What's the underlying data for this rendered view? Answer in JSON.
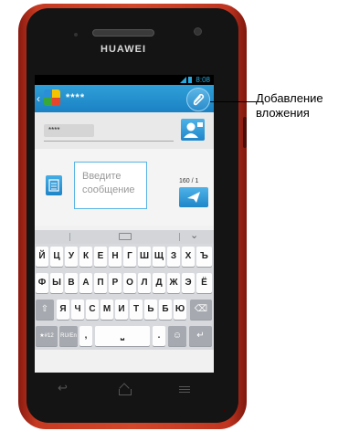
{
  "device": {
    "brand": "HUAWEI"
  },
  "status_bar": {
    "time": "8:08",
    "color": "#2aa9e0"
  },
  "header": {
    "back_glyph": "‹",
    "title": "****",
    "accent": "#1b82c4"
  },
  "annotation": {
    "label_line1": "Добавление",
    "label_line2": "вложения"
  },
  "recipients": {
    "chip": "****"
  },
  "compose": {
    "placeholder_line1": "Введите",
    "placeholder_line2": "сообщение",
    "counter": "160 / 1"
  },
  "keyboard": {
    "row1": [
      "Й",
      "Ц",
      "У",
      "К",
      "Е",
      "Н",
      "Г",
      "Ш",
      "Щ",
      "З",
      "Х",
      "Ъ"
    ],
    "row2": [
      "Ф",
      "Ы",
      "В",
      "А",
      "П",
      "Р",
      "О",
      "Л",
      "Д",
      "Ж",
      "Э",
      "Ё"
    ],
    "row3": [
      "Я",
      "Ч",
      "С",
      "М",
      "И",
      "Т",
      "Ь",
      "Б",
      "Ю"
    ],
    "shift": "⇧",
    "backspace": "⌫",
    "symbols": "★#12",
    "lang": "RU/En",
    "comma": ",",
    "space": "⎵",
    "period": ".",
    "emoji": "☺",
    "enter": "↵"
  },
  "nav": {
    "back": "↩"
  }
}
